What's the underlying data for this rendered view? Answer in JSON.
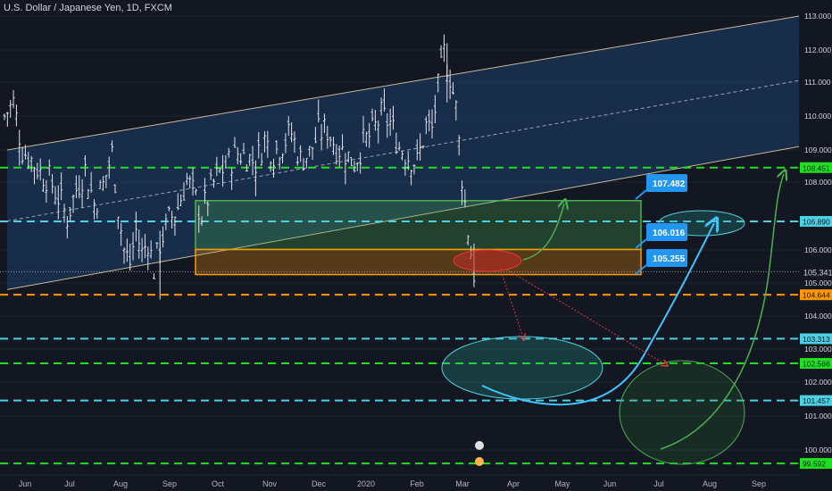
{
  "header": {
    "symbol_title": "U.S. Dollar / Japanese Yen, 1D, FXCM"
  },
  "chart_data": {
    "type": "candlestick",
    "symbol": "USD/JPY",
    "timeframe": "1D",
    "source": "FXCM",
    "x_ticks": [
      "Jun",
      "Jul",
      "Aug",
      "Sep",
      "Oct",
      "Nov",
      "Dec",
      "2020",
      "Feb",
      "Mar",
      "Apr",
      "May",
      "Jun",
      "Jul",
      "Aug",
      "Sep"
    ],
    "y_ticks": [
      "113.000",
      "112.000",
      "111.000",
      "110.000",
      "109.000",
      "108.000",
      "106.000",
      "105.000",
      "104.000",
      "103.000",
      "102.000",
      "101.000",
      "100.000"
    ],
    "ylim": [
      99.3,
      113.2
    ],
    "price_path": [
      [
        0,
        110.0
      ],
      [
        3,
        110.4
      ],
      [
        6,
        109.0
      ],
      [
        9,
        108.7
      ],
      [
        12,
        108.3
      ],
      [
        15,
        108.1
      ],
      [
        18,
        107.6
      ],
      [
        21,
        107.0
      ],
      [
        24,
        107.8
      ],
      [
        27,
        108.4
      ],
      [
        30,
        107.4
      ],
      [
        33,
        107.9
      ],
      [
        36,
        108.9
      ],
      [
        38,
        107.3
      ],
      [
        40,
        106.0
      ],
      [
        42,
        105.6
      ],
      [
        44,
        106.6
      ],
      [
        46,
        105.9
      ],
      [
        48,
        106.3
      ],
      [
        50,
        105.4
      ],
      [
        52,
        106.2
      ],
      [
        55,
        106.9
      ],
      [
        58,
        107.3
      ],
      [
        61,
        108.1
      ],
      [
        63,
        107.7
      ],
      [
        66,
        107.1
      ],
      [
        69,
        107.8
      ],
      [
        72,
        108.3
      ],
      [
        75,
        108.6
      ],
      [
        78,
        108.9
      ],
      [
        81,
        108.8
      ],
      [
        84,
        108.6
      ],
      [
        87,
        109.3
      ],
      [
        90,
        108.9
      ],
      [
        93,
        109.2
      ],
      [
        96,
        109.5
      ],
      [
        99,
        108.7
      ],
      [
        102,
        108.9
      ],
      [
        105,
        109.5
      ],
      [
        108,
        109.6
      ],
      [
        111,
        109.1
      ],
      [
        114,
        108.9
      ],
      [
        117,
        108.6
      ],
      [
        120,
        109.2
      ],
      [
        123,
        109.5
      ],
      [
        126,
        110.0
      ],
      [
        129,
        109.8
      ],
      [
        132,
        109.1
      ],
      [
        135,
        108.8
      ],
      [
        138,
        108.6
      ],
      [
        141,
        109.7
      ],
      [
        143,
        109.6
      ],
      [
        145,
        110.8
      ],
      [
        147,
        111.9
      ],
      [
        149,
        111.2
      ],
      [
        151,
        110.2
      ],
      [
        153,
        108.2
      ],
      [
        155,
        106.6
      ],
      [
        157,
        105.3
      ],
      [
        158,
        105.2
      ]
    ],
    "horizontal_levels": [
      {
        "label": "108.451",
        "value": 108.451,
        "color": "#21e021",
        "style": "dashed"
      },
      {
        "label": "106.890",
        "value": 106.89,
        "color": "#4dd0e1",
        "style": "dashed"
      },
      {
        "label": "105.341",
        "value": 105.341,
        "color": "#9e9e9e",
        "style": "dotted",
        "current_price": true
      },
      {
        "label": "104.644",
        "value": 104.644,
        "color": "#ff9800",
        "style": "dashed"
      },
      {
        "label": "103.313",
        "value": 103.313,
        "color": "#4dd0e1",
        "style": "dashed"
      },
      {
        "label": "102.566",
        "value": 102.566,
        "color": "#21e021",
        "style": "dashed"
      },
      {
        "label": "101.457",
        "value": 101.457,
        "color": "#4dd0e1",
        "style": "dashed"
      },
      {
        "label": "99.592",
        "value": 99.592,
        "color": "#21e021",
        "style": "dashed"
      }
    ],
    "zones": [
      {
        "name": "green-zone",
        "from": 106.016,
        "to": 107.482,
        "color": "#4caf50",
        "callout_label": "107.482"
      },
      {
        "name": "orange-zone",
        "from": 105.255,
        "to": 106.016,
        "color": "#ff9800",
        "callout_labels": [
          "106.016",
          "105.255"
        ]
      }
    ],
    "channel": {
      "upper": [
        [
          0,
          109.0
        ],
        [
          1,
          113.0
        ]
      ],
      "lower": [
        [
          0,
          104.8
        ],
        [
          1,
          109.1
        ]
      ],
      "mid": [
        [
          0,
          106.9
        ],
        [
          1,
          111.05
        ]
      ],
      "color": "#1e4a7a"
    }
  }
}
